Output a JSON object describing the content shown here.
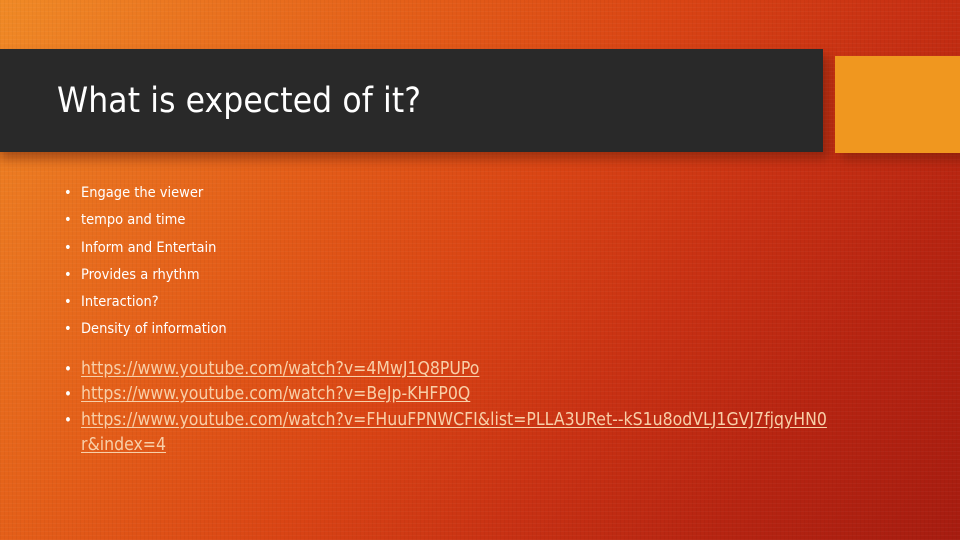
{
  "slide": {
    "title": "What is expected of it?",
    "background": {
      "gradient_start": "#f08a26",
      "gradient_mid": "#d94414",
      "gradient_end": "#a61c10"
    },
    "title_band_color": "#292929",
    "title_text_color": "#ffffff",
    "accent_block_color": "#f0971f",
    "link_color": "#f8cfa8",
    "bullet_glyph": "•"
  },
  "bullets": [
    {
      "text": "Engage the viewer"
    },
    {
      "text": "tempo and time"
    },
    {
      "text": "Inform and Entertain"
    },
    {
      "text": "Provides a rhythm"
    },
    {
      "text": "Interaction?"
    },
    {
      "text": "Density of information"
    }
  ],
  "links": [
    {
      "text": "https://www.youtube.com/watch?v=4MwJ1Q8PUPo"
    },
    {
      "text": "https://www.youtube.com/watch?v=BeJp-KHFP0Q"
    },
    {
      "text": "https://www.youtube.com/watch?v=FHuuFPNWCFI&list=PLLA3URet--kS1u8odVLJ1GVJ7fjqyHN0r&index=4"
    }
  ]
}
